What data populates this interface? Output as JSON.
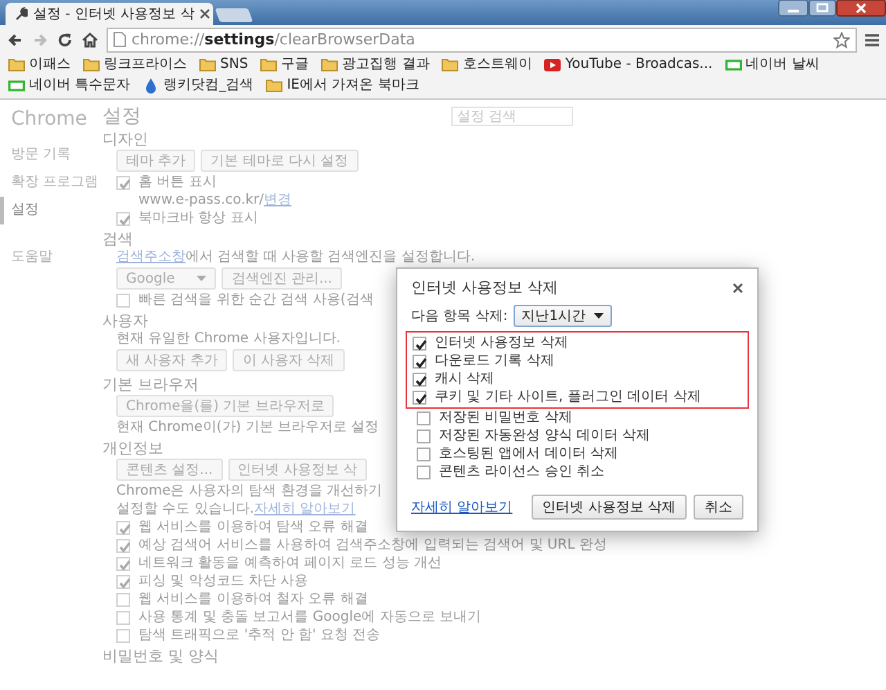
{
  "window": {
    "tab_title": "설정 - 인터넷 사용정보 삭"
  },
  "toolbar": {
    "url": "chrome://**settings**/clearBrowserData",
    "buttons": [
      {
        "kind": "back",
        "disabled": false
      },
      {
        "kind": "forward",
        "disabled": true
      },
      {
        "kind": "reload",
        "disabled": false
      },
      {
        "kind": "home",
        "disabled": false
      }
    ]
  },
  "bookmarks": [
    {
      "label": "이패스",
      "kind": "folder"
    },
    {
      "label": "링크프라이스",
      "kind": "folder"
    },
    {
      "label": "SNS",
      "kind": "folder"
    },
    {
      "label": "구글",
      "kind": "folder"
    },
    {
      "label": "광고집행 결과",
      "kind": "folder"
    },
    {
      "label": "호스트웨이",
      "kind": "folder"
    },
    {
      "label": "YouTube - Broadcas...",
      "kind": "video"
    },
    {
      "label": "네이버 날씨",
      "kind": "portal"
    },
    {
      "label": "네이버 특수문자",
      "kind": "portal"
    },
    {
      "label": "랭키닷컴_검색",
      "kind": "drop"
    },
    {
      "label": "IE에서 가져온 북마크",
      "kind": "folder"
    }
  ],
  "settings": {
    "sidebar": {
      "title": "Chrome",
      "items": [
        {
          "label": "방문 기록",
          "selected": false
        },
        {
          "label": "확장 프로그램",
          "selected": false
        },
        {
          "label": "설정",
          "selected": true
        },
        {
          "label": "도움말",
          "selected": false
        }
      ]
    },
    "heading": "설정",
    "search": {
      "placeholder": "설정 검색"
    },
    "sections": [
      {
        "title": "디자인",
        "rows": [
          {
            "kind": "buttons",
            "buttons": [
              "테마 추가",
              "기본 테마로 다시 설정"
            ]
          },
          {
            "kind": "checkbox",
            "label": "홈 버튼 표시",
            "checked": true
          },
          {
            "kind": "subtext",
            "parts": [
              {
                "text": "www.e-pass.co.kr/ ",
                "kind": "plain"
              },
              {
                "text": "변경",
                "kind": "link"
              }
            ]
          },
          {
            "kind": "checkbox",
            "label": "북마크바 항상 표시",
            "checked": true
          }
        ]
      },
      {
        "title": "검색",
        "rows": [
          {
            "kind": "text",
            "parts": [
              {
                "text": "검색주소창",
                "kind": "link"
              },
              {
                "text": "에서 검색할 때 사용할 검색엔진을 설정합니다.",
                "kind": "plain"
              }
            ]
          },
          {
            "kind": "select",
            "value": "Google",
            "button": "검색엔진 관리..."
          },
          {
            "kind": "checkbox",
            "label": "빠른 검색을 위한 순간 검색 사용(검색",
            "checked": false
          }
        ]
      },
      {
        "title": "사용자",
        "rows": [
          {
            "kind": "text",
            "parts": [
              {
                "text": "현재 유일한 Chrome 사용자입니다.",
                "kind": "plain"
              }
            ]
          },
          {
            "kind": "buttons",
            "buttons": [
              "새 사용자 추가",
              "이 사용자 삭제"
            ]
          }
        ]
      },
      {
        "title": "기본 브라우저",
        "rows": [
          {
            "kind": "buttons",
            "buttons": [
              "Chrome을(를) 기본 브라우저로"
            ]
          },
          {
            "kind": "text",
            "parts": [
              {
                "text": "현재 Chrome이(가) 기본 브라우저로 설정",
                "kind": "plain"
              }
            ]
          }
        ]
      },
      {
        "title": "개인정보",
        "rows": [
          {
            "kind": "buttons",
            "buttons": [
              "콘텐츠 설정...",
              "인터넷 사용정보 삭"
            ]
          },
          {
            "kind": "text",
            "parts": [
              {
                "text": "Chrome은 사용자의 탐색 환경을 개선하기",
                "kind": "plain"
              }
            ]
          },
          {
            "kind": "text",
            "parts": [
              {
                "text": "설정할 수도 있습니다. ",
                "kind": "plain"
              },
              {
                "text": "자세히 알아보기",
                "kind": "link"
              }
            ]
          },
          {
            "kind": "checkbox",
            "label": "웹 서비스를 이용하여 탐색 오류 해결",
            "checked": true
          },
          {
            "kind": "checkbox",
            "label": "예상 검색어 서비스를 사용하여 검색주소창에 입력되는 검색어 및 URL 완성",
            "checked": true
          },
          {
            "kind": "checkbox",
            "label": "네트워크 활동을 예측하여 페이지 로드 성능 개선",
            "checked": true
          },
          {
            "kind": "checkbox",
            "label": "피싱 및 악성코드 차단 사용",
            "checked": true
          },
          {
            "kind": "checkbox",
            "label": "웹 서비스를 이용하여 철자 오류 해결",
            "checked": false
          },
          {
            "kind": "checkbox",
            "label": "사용 통계 및 충돌 보고서를 Google에 자동으로 보내기",
            "checked": false
          },
          {
            "kind": "checkbox",
            "label": "탐색 트래픽으로 '추적 안 함' 요청 전송",
            "checked": false
          }
        ]
      },
      {
        "title": "비밀번호 및 양식"
      }
    ]
  },
  "dialog": {
    "title": "인터넷 사용정보 삭제",
    "range_label": "다음 항목 삭제:",
    "range": "지난1시간",
    "options": [
      {
        "label": "인터넷 사용정보 삭제",
        "checked": true,
        "highlighted": true
      },
      {
        "label": "다운로드 기록 삭제",
        "checked": true,
        "highlighted": true
      },
      {
        "label": "캐시 삭제",
        "checked": true,
        "highlighted": true
      },
      {
        "label": "쿠키 및 기타 사이트, 플러그인 데이터 삭제",
        "checked": true,
        "highlighted": true
      },
      {
        "label": "저장된 비밀번호 삭제",
        "checked": false,
        "highlighted": false
      },
      {
        "label": "저장된 자동완성 양식 데이터 삭제",
        "checked": false,
        "highlighted": false
      },
      {
        "label": "호스팅된 앱에서 데이터 삭제",
        "checked": false,
        "highlighted": false
      },
      {
        "label": "콘텐츠 라이선스 승인 취소",
        "checked": false,
        "highlighted": false
      }
    ],
    "link": "자세히 알아보기",
    "buttons": [
      "인터넷 사용정보 삭제",
      "취소"
    ]
  }
}
